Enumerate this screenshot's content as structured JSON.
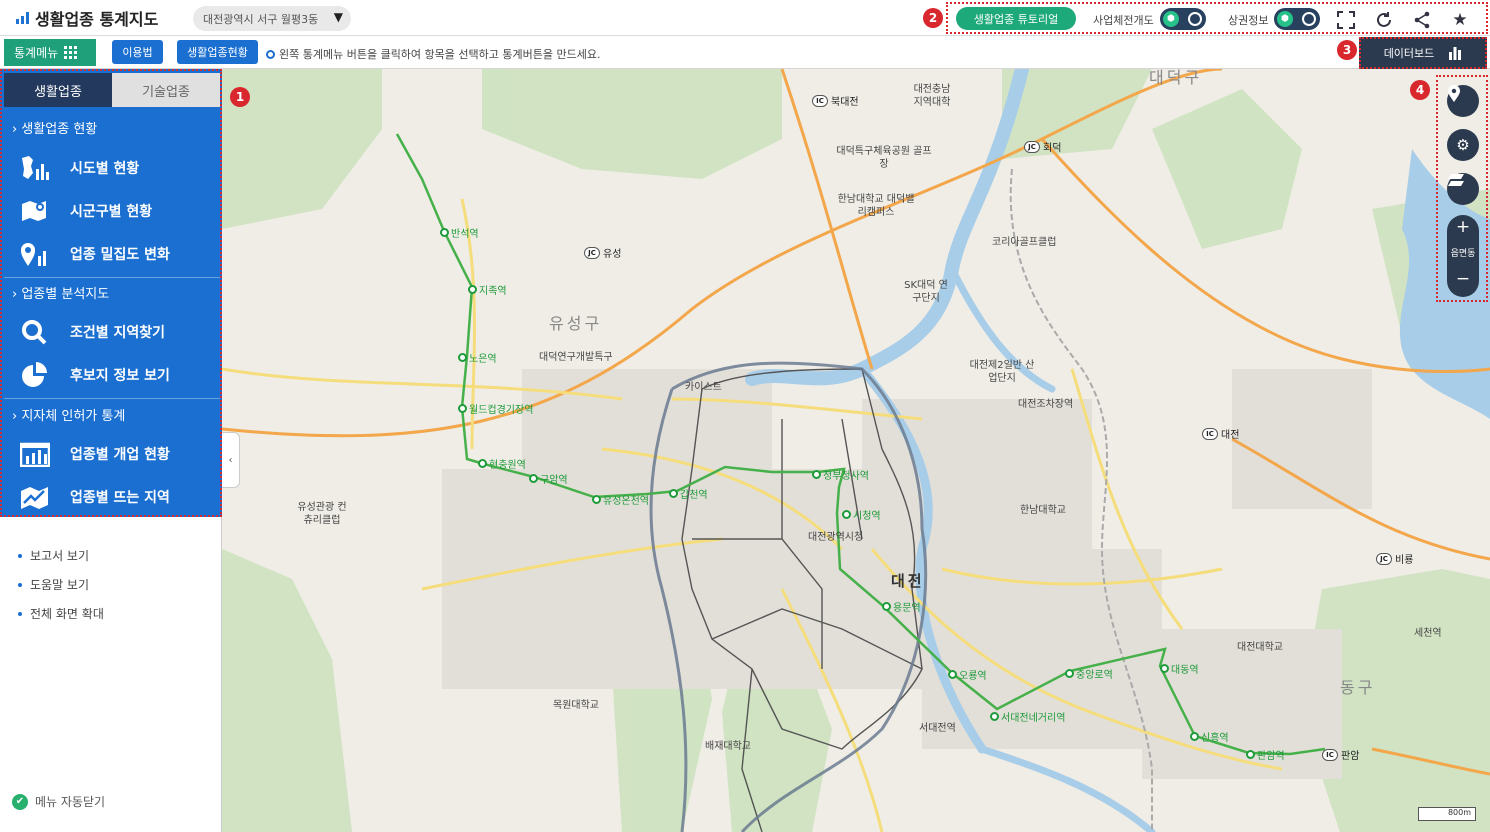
{
  "app": {
    "title": "생활업종 통계지도",
    "region": "대전광역시 서구 월평3동"
  },
  "topbar": {
    "tutorial": "생활업종 튜토리얼",
    "toggle1_label": "사업체전개도",
    "toggle2_label": "상권정보"
  },
  "subbar": {
    "stat_menu": "통계메뉴",
    "usage": "이용법",
    "status": "생활업종현황",
    "hint": "왼쪽 통계메뉴 버튼을 클릭하여 항목을 선택하고 통계버튼을 만드세요.",
    "dashboard": "데이터보드"
  },
  "badges": [
    "1",
    "2",
    "3",
    "4"
  ],
  "panel": {
    "tabs": [
      "생활업종",
      "기술업종"
    ],
    "sections": [
      {
        "title": "생활업종 현황",
        "items": [
          "시도별 현황",
          "시군구별 현황",
          "업종 밀집도 변화"
        ]
      },
      {
        "title": "업종별 분석지도",
        "items": [
          "조건별 지역찾기",
          "후보지 정보 보기"
        ]
      },
      {
        "title": "지자체 인허가 통계",
        "items": [
          "업종별 개업 현황",
          "업종별 뜨는 지역"
        ]
      }
    ],
    "links": [
      "보고서 보기",
      "도움말 보기",
      "전체 화면 확대"
    ],
    "auto_close": "메뉴 자동닫기"
  },
  "map": {
    "zoom_label": "읍면동",
    "scale": "800m",
    "areas": [
      "대덕구",
      "유성구",
      "대전",
      "동구"
    ],
    "places": [
      "대전충남 지역대학",
      "대덕특구체육공원 골프장",
      "한남대학교 대덕밸리캠퍼스",
      "SK대덕 연구단지",
      "대덕연구개발특구",
      "카이스트",
      "대전제2일반 산업단지",
      "대전조차장역",
      "한남대학교",
      "대전광역시청",
      "유성관광 컨츄리클럽",
      "목원대학교",
      "배재대학교",
      "서대전역",
      "대전대학교",
      "세천역",
      "코리아골프클럽"
    ],
    "interchanges": [
      "북대전",
      "회덕",
      "유성",
      "대전",
      "비룡",
      "판암"
    ],
    "stations": [
      "반석역",
      "지족역",
      "노은역",
      "월드컵경기장역",
      "현충원역",
      "구암역",
      "유성온천역",
      "갑천역",
      "정부청사역",
      "시청역",
      "용문역",
      "오룡역",
      "서대전네거리역",
      "중앙로역",
      "대동역",
      "신흥역",
      "판암역"
    ]
  }
}
